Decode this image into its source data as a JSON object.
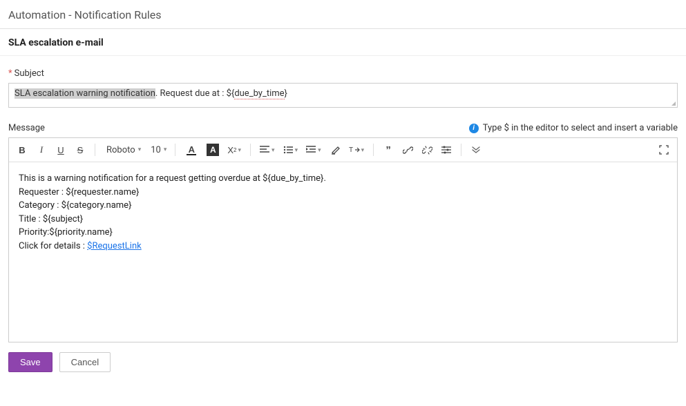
{
  "header": {
    "title": "Automation - Notification Rules"
  },
  "section": {
    "title": "SLA escalation e-mail"
  },
  "subject": {
    "label": "Subject",
    "highlighted": "SLA escalation warning notification",
    "middle": ". Request due at : ${",
    "spellerr": "due_by_time",
    "end": "}"
  },
  "message": {
    "label": "Message",
    "hint": "Type $ in the editor to select and insert a variable"
  },
  "toolbar": {
    "font_family": "Roboto",
    "font_size": "10"
  },
  "body": {
    "line1": "This is a warning notification for a request getting overdue at ${due_by_time}.",
    "line2": "Requester : ${requester.name}",
    "line3": "Category : ${category.name}",
    "line4": "Title : ${subject}",
    "line5": "Priority:${priority.name}",
    "line6_prefix": "Click for details : ",
    "link_text": "$RequestLink"
  },
  "footer": {
    "save": "Save",
    "cancel": "Cancel"
  }
}
